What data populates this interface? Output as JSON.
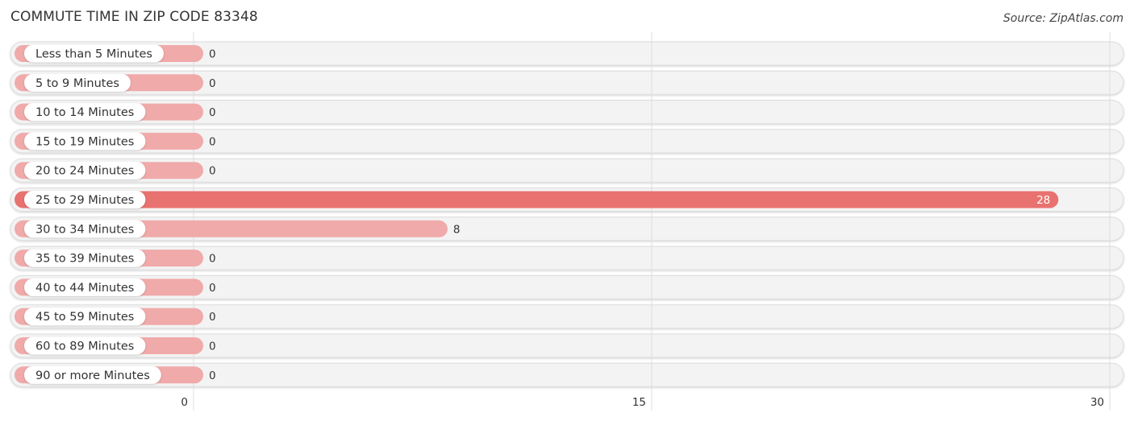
{
  "header": {
    "title": "COMMUTE TIME IN ZIP CODE 83348",
    "source": "Source: ZipAtlas.com"
  },
  "colors": {
    "bar_normal": "#f0aaaa",
    "bar_highlight": "#e8726f",
    "row_bg": "#f3f3f3",
    "row_border": "#dddddd",
    "grid": "#dddddd"
  },
  "chart_data": {
    "type": "bar",
    "orientation": "horizontal",
    "title": "COMMUTE TIME IN ZIP CODE 83348",
    "source": "Source: ZipAtlas.com",
    "xlabel": "",
    "ylabel": "",
    "xlim": [
      0,
      30
    ],
    "xticks": [
      0,
      15,
      30
    ],
    "xtick_labels": [
      "0",
      "15",
      "30"
    ],
    "grid": true,
    "categories": [
      "Less than 5 Minutes",
      "5 to 9 Minutes",
      "10 to 14 Minutes",
      "15 to 19 Minutes",
      "20 to 24 Minutes",
      "25 to 29 Minutes",
      "30 to 34 Minutes",
      "35 to 39 Minutes",
      "40 to 44 Minutes",
      "45 to 59 Minutes",
      "60 to 89 Minutes",
      "90 or more Minutes"
    ],
    "values": [
      0,
      0,
      0,
      0,
      0,
      28,
      8,
      0,
      0,
      0,
      0,
      0
    ],
    "value_labels": [
      "0",
      "0",
      "0",
      "0",
      "0",
      "28",
      "8",
      "0",
      "0",
      "0",
      "0",
      "0"
    ],
    "highlight_index": 5
  }
}
